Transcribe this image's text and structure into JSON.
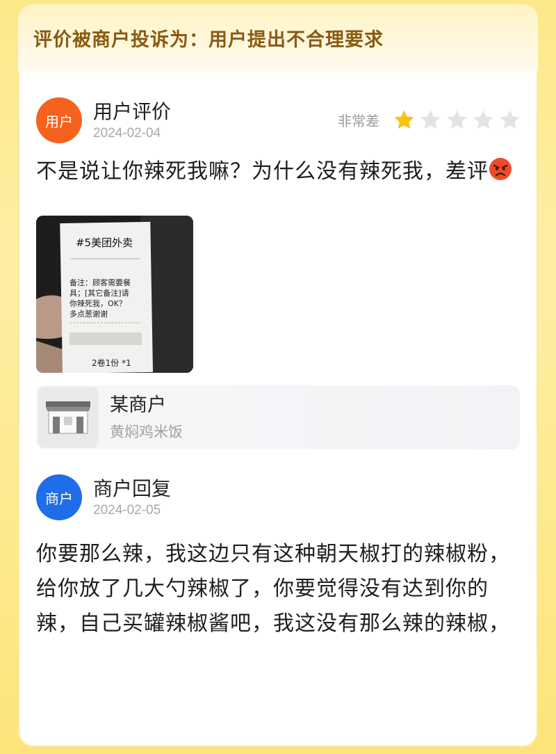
{
  "header": {
    "title": "评价被商户投诉为：用户提出不合理要求"
  },
  "review": {
    "avatar_label": "用户",
    "author": "用户评价",
    "date": "2024-02-04",
    "rating_text": "非常差",
    "rating": 1,
    "rating_max": 5,
    "text": "不是说让你辣死我嘛？为什么没有辣死我，差评",
    "emoji": "angry-face",
    "photo": {
      "receipt_title": "#5美团外卖",
      "receipt_note": "备注：顾客需要餐具；[其它备注]请你辣死我，OK？多点葱谢谢",
      "receipt_footer": "2卷1份 *1"
    }
  },
  "shop": {
    "name": "某商户",
    "category": "黄焖鸡米饭",
    "icon": "storefront-icon"
  },
  "reply": {
    "avatar_label": "商户",
    "author": "商户回复",
    "date": "2024-02-05",
    "text": "你要那么辣，我这边只有这种朝天椒打的辣椒粉，给你放了几大勺辣椒了，你要觉得没有达到你的辣，自己买罐辣椒酱吧，我这没有那么辣的辣椒，"
  },
  "colors": {
    "background": "#fde88a",
    "header_text": "#8a5a12",
    "user_avatar": "#f4621e",
    "merchant_avatar": "#1f6de8",
    "star_filled": "#f9c316",
    "star_empty": "#e3e3e3"
  }
}
